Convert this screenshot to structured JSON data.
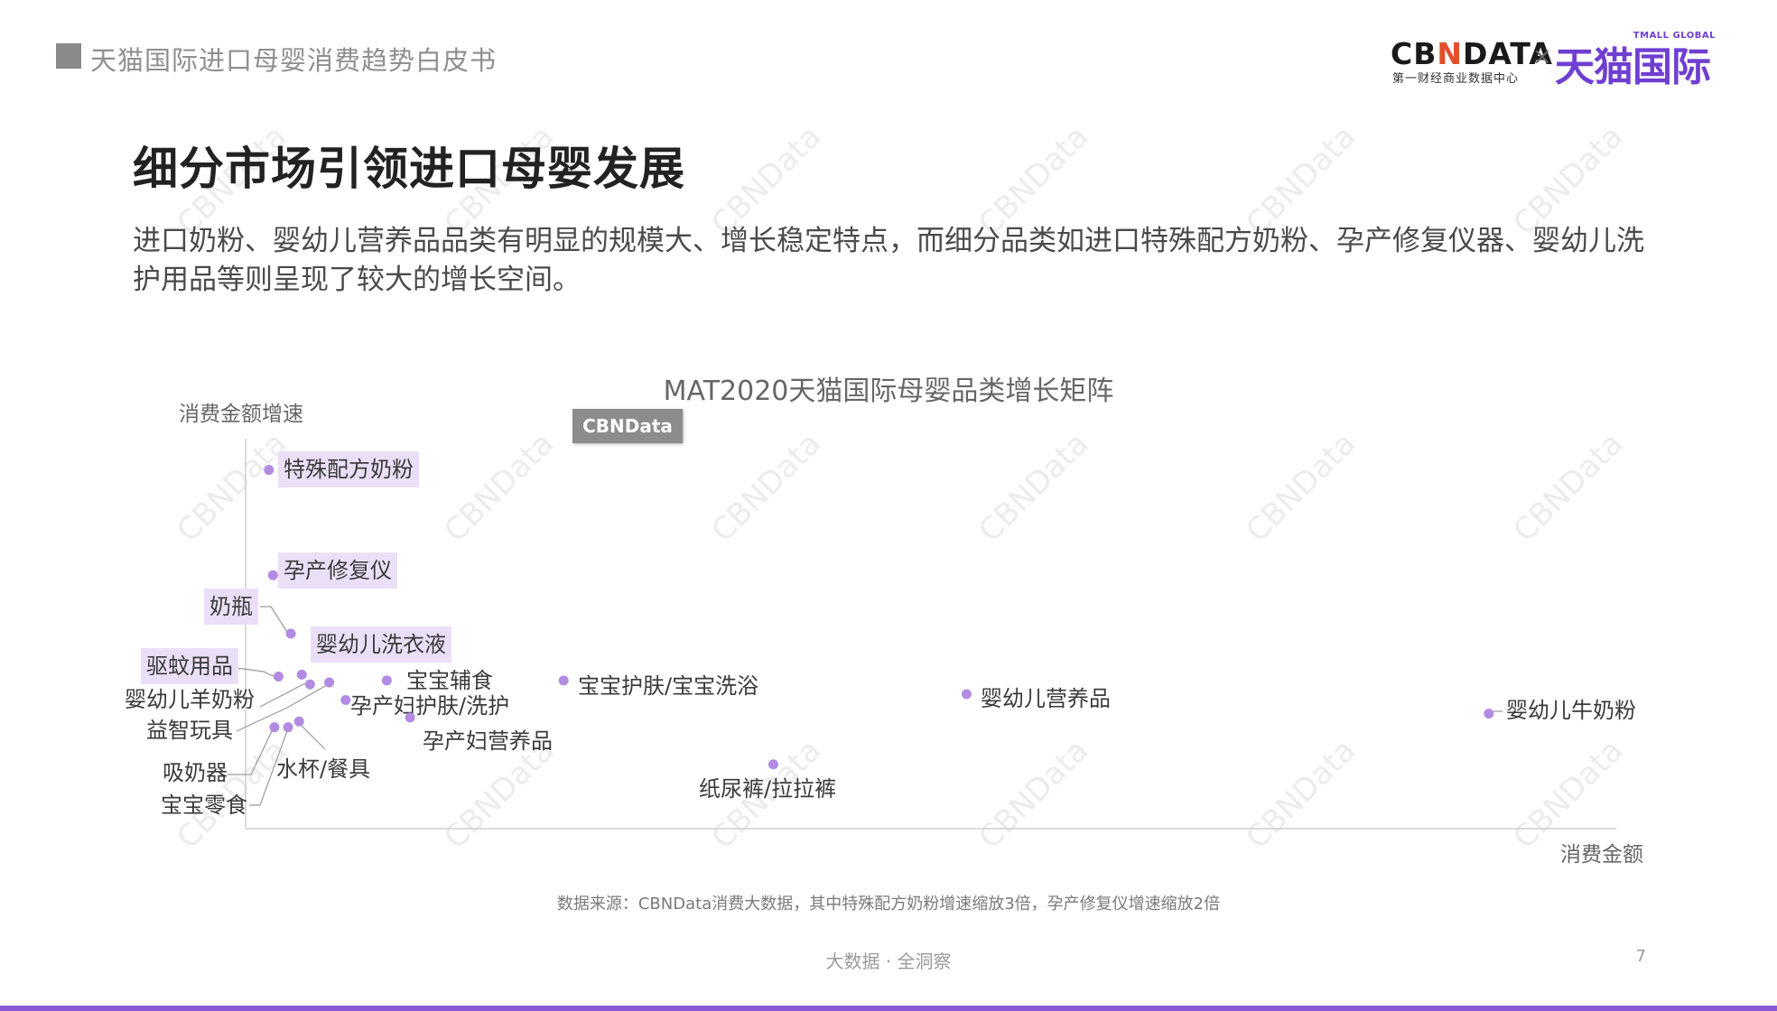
{
  "header": {
    "title": "天猫国际进口母婴消费趋势白皮书"
  },
  "logo": {
    "cbn_pre": "CB",
    "cbn_n": "N",
    "cbn_post": "DATA",
    "cbn_sub": "第一财经商业数据中心",
    "times": "×",
    "tmall": "天猫国际",
    "tmall_en": "TMALL GLOBAL"
  },
  "main": {
    "title": "细分市场引领进口母婴发展",
    "lead": "进口奶粉、婴幼儿营养品品类有明显的规模大、增长稳定特点，而细分品类如进口特殊配方奶粉、孕产修复仪器、婴幼儿洗护用品等则呈现了较大的增长空间。",
    "badge": "CBNData",
    "watermark": "CBNData"
  },
  "chart_data": {
    "type": "scatter",
    "title": "MAT2020天猫国际母婴品类增长矩阵",
    "xlabel": "消费金额",
    "ylabel": "消费金额增速",
    "grid": false,
    "highlight_color": "#ebdff7",
    "point_color": "#b38be3",
    "points": [
      {
        "label": "特殊配方奶粉",
        "x": 1.7,
        "y": 92.0,
        "highlight": true
      },
      {
        "label": "孕产修复仪",
        "x": 2.0,
        "y": 65.0,
        "highlight": true
      },
      {
        "label": "奶瓶",
        "x": 3.3,
        "y": 50.0,
        "highlight": true
      },
      {
        "label": "婴幼儿洗衣液",
        "x": 4.1,
        "y": 39.5,
        "highlight": true
      },
      {
        "label": "驱蚊用品",
        "x": 2.4,
        "y": 39.0,
        "highlight": true
      },
      {
        "label": "婴幼儿羊奶粉",
        "x": 4.7,
        "y": 37.0,
        "highlight": false
      },
      {
        "label": "宝宝辅食",
        "x": 10.3,
        "y": 38.0,
        "highlight": false
      },
      {
        "label": "孕产妇护肤/洗护",
        "x": 7.3,
        "y": 33.0,
        "highlight": false
      },
      {
        "label": "益智玩具",
        "x": 6.1,
        "y": 37.5,
        "highlight": false
      },
      {
        "label": "孕产妇营养品",
        "x": 12.0,
        "y": 28.5,
        "highlight": false
      },
      {
        "label": "吸奶器",
        "x": 2.1,
        "y": 26.0,
        "highlight": false
      },
      {
        "label": "宝宝零食",
        "x": 3.1,
        "y": 26.0,
        "highlight": false
      },
      {
        "label": "水杯/餐具",
        "x": 3.9,
        "y": 27.5,
        "highlight": false
      },
      {
        "label": "宝宝护肤/宝宝洗浴",
        "x": 23.2,
        "y": 38.0,
        "highlight": false
      },
      {
        "label": "纸尿裤/拉拉裤",
        "x": 38.5,
        "y": 16.5,
        "highlight": false
      },
      {
        "label": "婴幼儿营养品",
        "x": 52.6,
        "y": 34.5,
        "highlight": false
      },
      {
        "label": "婴幼儿牛奶粉",
        "x": 90.7,
        "y": 29.5,
        "highlight": false
      }
    ]
  },
  "footer": {
    "source": "数据来源：CBNData消费大数据，其中特殊配方奶粉增速缩放3倍，孕产修复仪增速缩放2倍",
    "tagline": "大数据 · 全洞察",
    "page_number": "7"
  }
}
